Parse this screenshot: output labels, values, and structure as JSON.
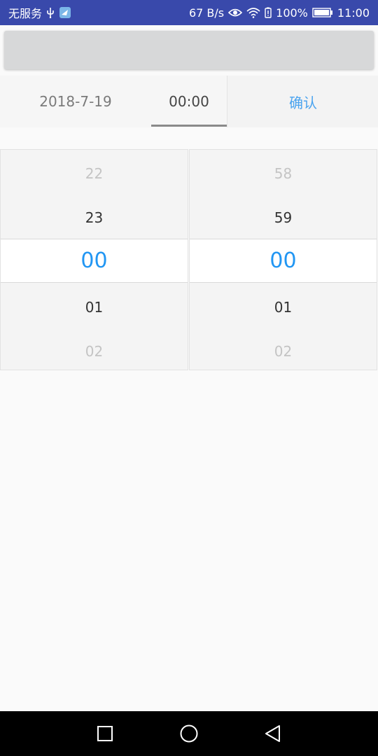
{
  "status_bar": {
    "carrier": "无服务",
    "net_speed": "67 B/s",
    "battery_percent": "100%",
    "time": "11:00",
    "icons": [
      "usb-icon",
      "app-notification-icon",
      "eye-icon",
      "wifi-icon",
      "battery-alert-icon",
      "battery-icon"
    ]
  },
  "tabs": {
    "date_label": "2018-7-19",
    "time_label": "00:00",
    "confirm_label": "确认"
  },
  "picker": {
    "hours": [
      "22",
      "23",
      "00",
      "01",
      "02"
    ],
    "minutes": [
      "58",
      "59",
      "00",
      "01",
      "02"
    ],
    "selected_color": "#2196f3"
  },
  "nav_bar": {
    "icons": [
      "recent-apps-icon",
      "home-icon",
      "back-icon"
    ]
  }
}
